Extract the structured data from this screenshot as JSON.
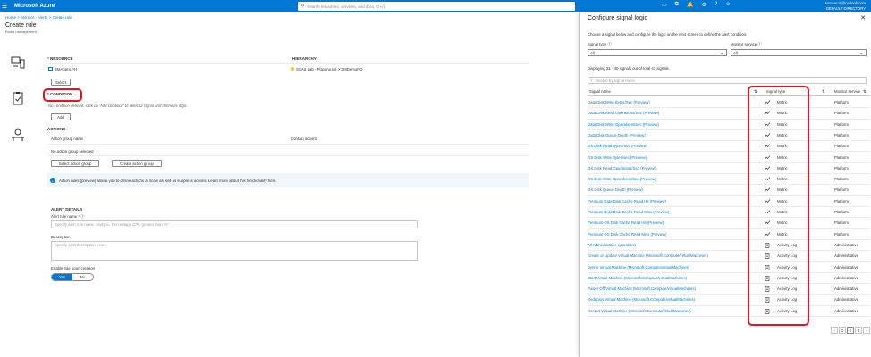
{
  "topbar": {
    "brand": "Microsoft Azure",
    "search_placeholder": "Search resources, services, and docs (G+/)",
    "user_email": "sameer.m@outlook.com",
    "user_directory": "DEFAULT DIRECTORY"
  },
  "breadcrumb": "Home > Monitor - Alerts > Create rule",
  "page": {
    "title": "Create rule",
    "subtitle": "Rules management"
  },
  "resource": {
    "header": "RESOURCE",
    "hierarchy_header": "HIERARCHY",
    "name": "SMAppnLPH",
    "hierarchy": "SSAS Lab - Playground  >  SMDemoRG",
    "select_label": "Select"
  },
  "condition": {
    "header": "CONDITION",
    "empty_text": "No condition defined, click on 'Add condition' to select a signal and define its logic",
    "add_label": "Add"
  },
  "actions": {
    "header": "ACTIONS",
    "col_name": "Action group name",
    "col_contain": "Contain actions",
    "empty": "No action group selected",
    "select_label": "Select action group",
    "create_label": "Create action group"
  },
  "info": "Action rules (preview) allows you to define actions at scale as well as suppress actions. Learn more about this functionality here.",
  "alert": {
    "header": "ALERT DETAILS",
    "name_label": "Alert rule name",
    "name_placeholder": "Specify alert rule name. Sample: 'Percentage CPU greater than 70'",
    "desc_label": "Description",
    "desc_placeholder": "Specify alert description here...",
    "enable_label": "Enable rule upon creation",
    "yes": "Yes",
    "no": "No"
  },
  "panel": {
    "title": "Configure signal logic",
    "desc": "Choose a signal below and configure the logic on the next screen to define the alert condition.",
    "signal_type_label": "Signal type",
    "signal_type_value": "All",
    "monitor_service_label": "Monitor service",
    "monitor_service_value": "All",
    "displaying": "Displaying 21 - 40 signals out of total 47 signals",
    "search_placeholder": "Search by signal name",
    "col_name": "Signal name",
    "col_type": "Signal type",
    "col_monitor": "Monitor service",
    "rows": [
      {
        "name": "Data Disk Write Bytes/Sec (Preview)",
        "type": "Metric",
        "monitor": "Platform"
      },
      {
        "name": "Data Disk Read Operations/Sec (Preview)",
        "type": "Metric",
        "monitor": "Platform"
      },
      {
        "name": "Data Disk Write Operations/Sec (Preview)",
        "type": "Metric",
        "monitor": "Platform"
      },
      {
        "name": "Data Disk Queue Depth (Preview)",
        "type": "Metric",
        "monitor": "Platform"
      },
      {
        "name": "OS Disk Read Bytes/Sec (Preview)",
        "type": "Metric",
        "monitor": "Platform"
      },
      {
        "name": "OS Disk Write Bytes/sec (Preview)",
        "type": "Metric",
        "monitor": "Platform"
      },
      {
        "name": "OS Disk Read Operations/Sec (Preview)",
        "type": "Metric",
        "monitor": "Platform"
      },
      {
        "name": "OS Disk Write Operations/Sec (Preview)",
        "type": "Metric",
        "monitor": "Platform"
      },
      {
        "name": "OS Disk Queue Depth (Preview)",
        "type": "Metric",
        "monitor": "Platform"
      },
      {
        "name": "Premium Data Disk Cache Read Hit (Preview)",
        "type": "Metric",
        "monitor": "Platform"
      },
      {
        "name": "Premium Data Disk Cache Read Miss (Preview)",
        "type": "Metric",
        "monitor": "Platform"
      },
      {
        "name": "Premium OS Disk Cache Read Hit (Preview)",
        "type": "Metric",
        "monitor": "Platform"
      },
      {
        "name": "Premium OS Disk Cache Read Miss (Preview)",
        "type": "Metric",
        "monitor": "Platform"
      },
      {
        "name": "All Administrative operations",
        "type": "Activity Log",
        "monitor": "Administrative"
      },
      {
        "name": "Create or Update Virtual Machine (Microsoft.Compute/virtualMachines)",
        "type": "Activity Log",
        "monitor": "Administrative"
      },
      {
        "name": "Delete Virtual Machine (Microsoft.Compute/virtualMachines)",
        "type": "Activity Log",
        "monitor": "Administrative"
      },
      {
        "name": "Start Virtual Machine (Microsoft.Compute/virtualMachines)",
        "type": "Activity Log",
        "monitor": "Administrative"
      },
      {
        "name": "Power Off Virtual Machine (Microsoft.Compute/virtualMachines)",
        "type": "Activity Log",
        "monitor": "Administrative"
      },
      {
        "name": "Redeploy Virtual Machine (Microsoft.Compute/virtualMachines)",
        "type": "Activity Log",
        "monitor": "Administrative"
      },
      {
        "name": "Restart Virtual Machine (Microsoft.Compute/virtualMachines)",
        "type": "Activity Log",
        "monitor": "Administrative"
      }
    ],
    "pager": [
      "1",
      "2",
      "3"
    ]
  }
}
